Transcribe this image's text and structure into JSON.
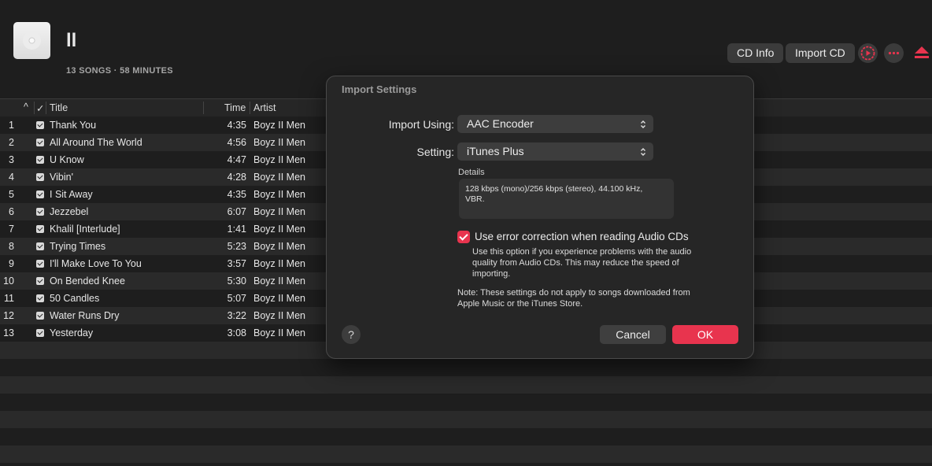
{
  "album": {
    "title": "ll",
    "meta": "13 SONGS · 58 MINUTES",
    "art_icon": "cd-disc-icon"
  },
  "header_buttons": {
    "cd_info": "CD Info",
    "import_cd": "Import CD",
    "icons": [
      "settings-play-icon",
      "more-icon",
      "eject-icon"
    ]
  },
  "columns": {
    "sort": "^",
    "check": "✓",
    "title": "Title",
    "time": "Time",
    "artist": "Artist"
  },
  "tracks": [
    {
      "num": "1",
      "title": "Thank You",
      "time": "4:35",
      "artist": "Boyz II Men"
    },
    {
      "num": "2",
      "title": "All Around The World",
      "time": "4:56",
      "artist": "Boyz II Men"
    },
    {
      "num": "3",
      "title": "U Know",
      "time": "4:47",
      "artist": "Boyz II Men"
    },
    {
      "num": "4",
      "title": "Vibin'",
      "time": "4:28",
      "artist": "Boyz II Men"
    },
    {
      "num": "5",
      "title": "I Sit Away",
      "time": "4:35",
      "artist": "Boyz II Men"
    },
    {
      "num": "6",
      "title": "Jezzebel",
      "time": "6:07",
      "artist": "Boyz II Men"
    },
    {
      "num": "7",
      "title": "Khalil [Interlude]",
      "time": "1:41",
      "artist": "Boyz II Men"
    },
    {
      "num": "8",
      "title": "Trying Times",
      "time": "5:23",
      "artist": "Boyz II Men"
    },
    {
      "num": "9",
      "title": "I'll Make Love To You",
      "time": "3:57",
      "artist": "Boyz II Men"
    },
    {
      "num": "10",
      "title": "On Bended Knee",
      "time": "5:30",
      "artist": "Boyz II Men"
    },
    {
      "num": "11",
      "title": "50 Candles",
      "time": "5:07",
      "artist": "Boyz II Men"
    },
    {
      "num": "12",
      "title": "Water Runs Dry",
      "time": "3:22",
      "artist": "Boyz II Men"
    },
    {
      "num": "13",
      "title": "Yesterday",
      "time": "3:08",
      "artist": "Boyz II Men"
    }
  ],
  "dialog": {
    "title": "Import Settings",
    "import_using_label": "Import Using:",
    "import_using_value": "AAC Encoder",
    "setting_label": "Setting:",
    "setting_value": "iTunes Plus",
    "details_label": "Details",
    "details_text": "128 kbps (mono)/256 kbps (stereo), 44.100 kHz, VBR.",
    "error_correction_label": "Use error correction when reading Audio CDs",
    "error_correction_checked": true,
    "error_correction_desc": "Use this option if you experience problems with the audio quality from Audio CDs. This may reduce the speed of importing.",
    "note": "Note: These settings do not apply to songs downloaded from Apple Music or the iTunes Store.",
    "help": "?",
    "cancel": "Cancel",
    "ok": "OK"
  },
  "colors": {
    "accent": "#e8344e",
    "background": "#1e1e1e",
    "row_alt": "#2a2a2a"
  }
}
